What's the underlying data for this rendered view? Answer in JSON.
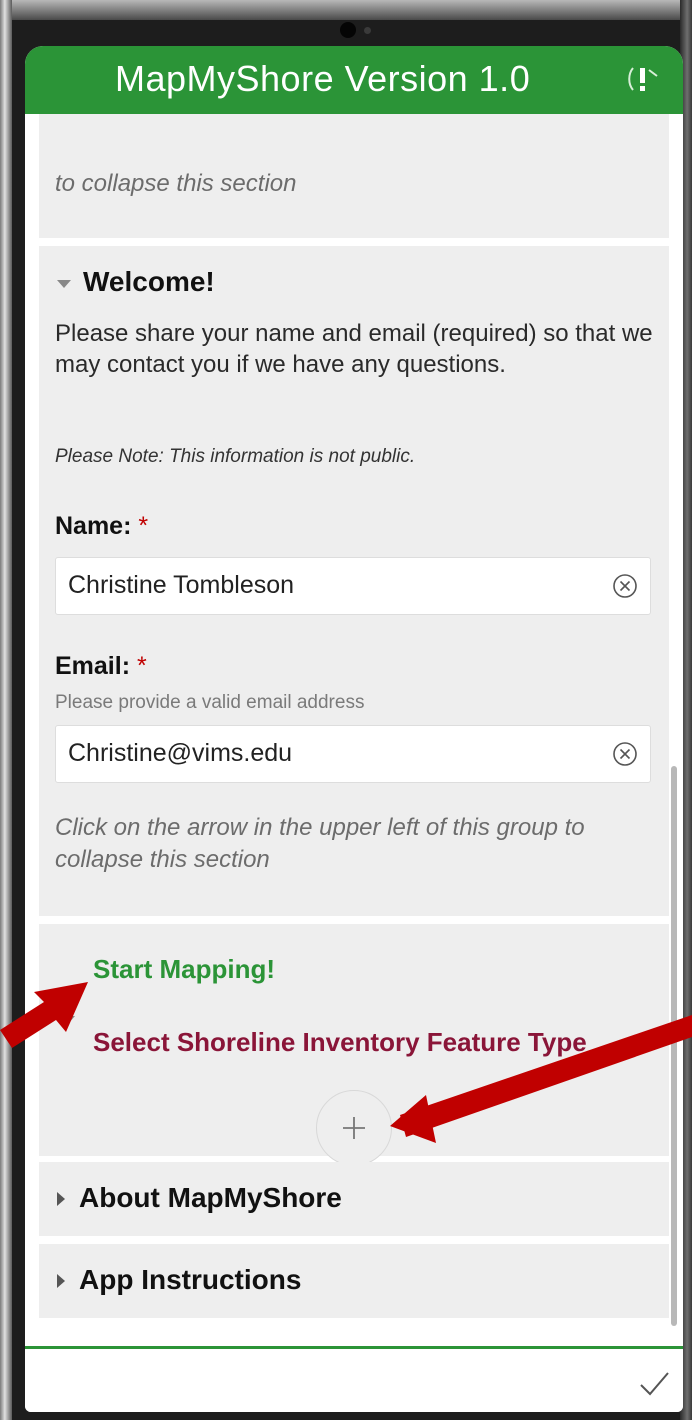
{
  "header": {
    "title": "MapMyShore Version 1.0"
  },
  "top_card": {
    "collapse_note": "to collapse this section"
  },
  "welcome": {
    "title": "Welcome!",
    "intro": "Please share your name and email (required) so that we may contact you if we have any questions.",
    "note": "Please Note: This information is not public.",
    "name_label": "Name:",
    "name_value": "Christine Tombleson",
    "email_label": "Email:",
    "email_hint": "Please provide a valid email address",
    "email_value": "Christine@vims.edu",
    "required_mark": "*",
    "collapse_note": "Click on the arrow in the upper left of this group to collapse this section"
  },
  "mapping": {
    "start_label": "Start Mapping!",
    "feature_type_label": "Select Shoreline Inventory Feature Type",
    "add_symbol": "+"
  },
  "about": {
    "title": "About MapMyShore"
  },
  "instructions": {
    "title": "App Instructions"
  },
  "colors": {
    "brand_green": "#2b9437",
    "maroon": "#8a1538",
    "required_red": "#c00000",
    "annotation_red": "#c00000"
  },
  "icons": [
    "clear-circle-icon",
    "check-icon",
    "sound-alert-icon",
    "chevron-down-icon",
    "chevron-right-icon",
    "plus-icon"
  ]
}
